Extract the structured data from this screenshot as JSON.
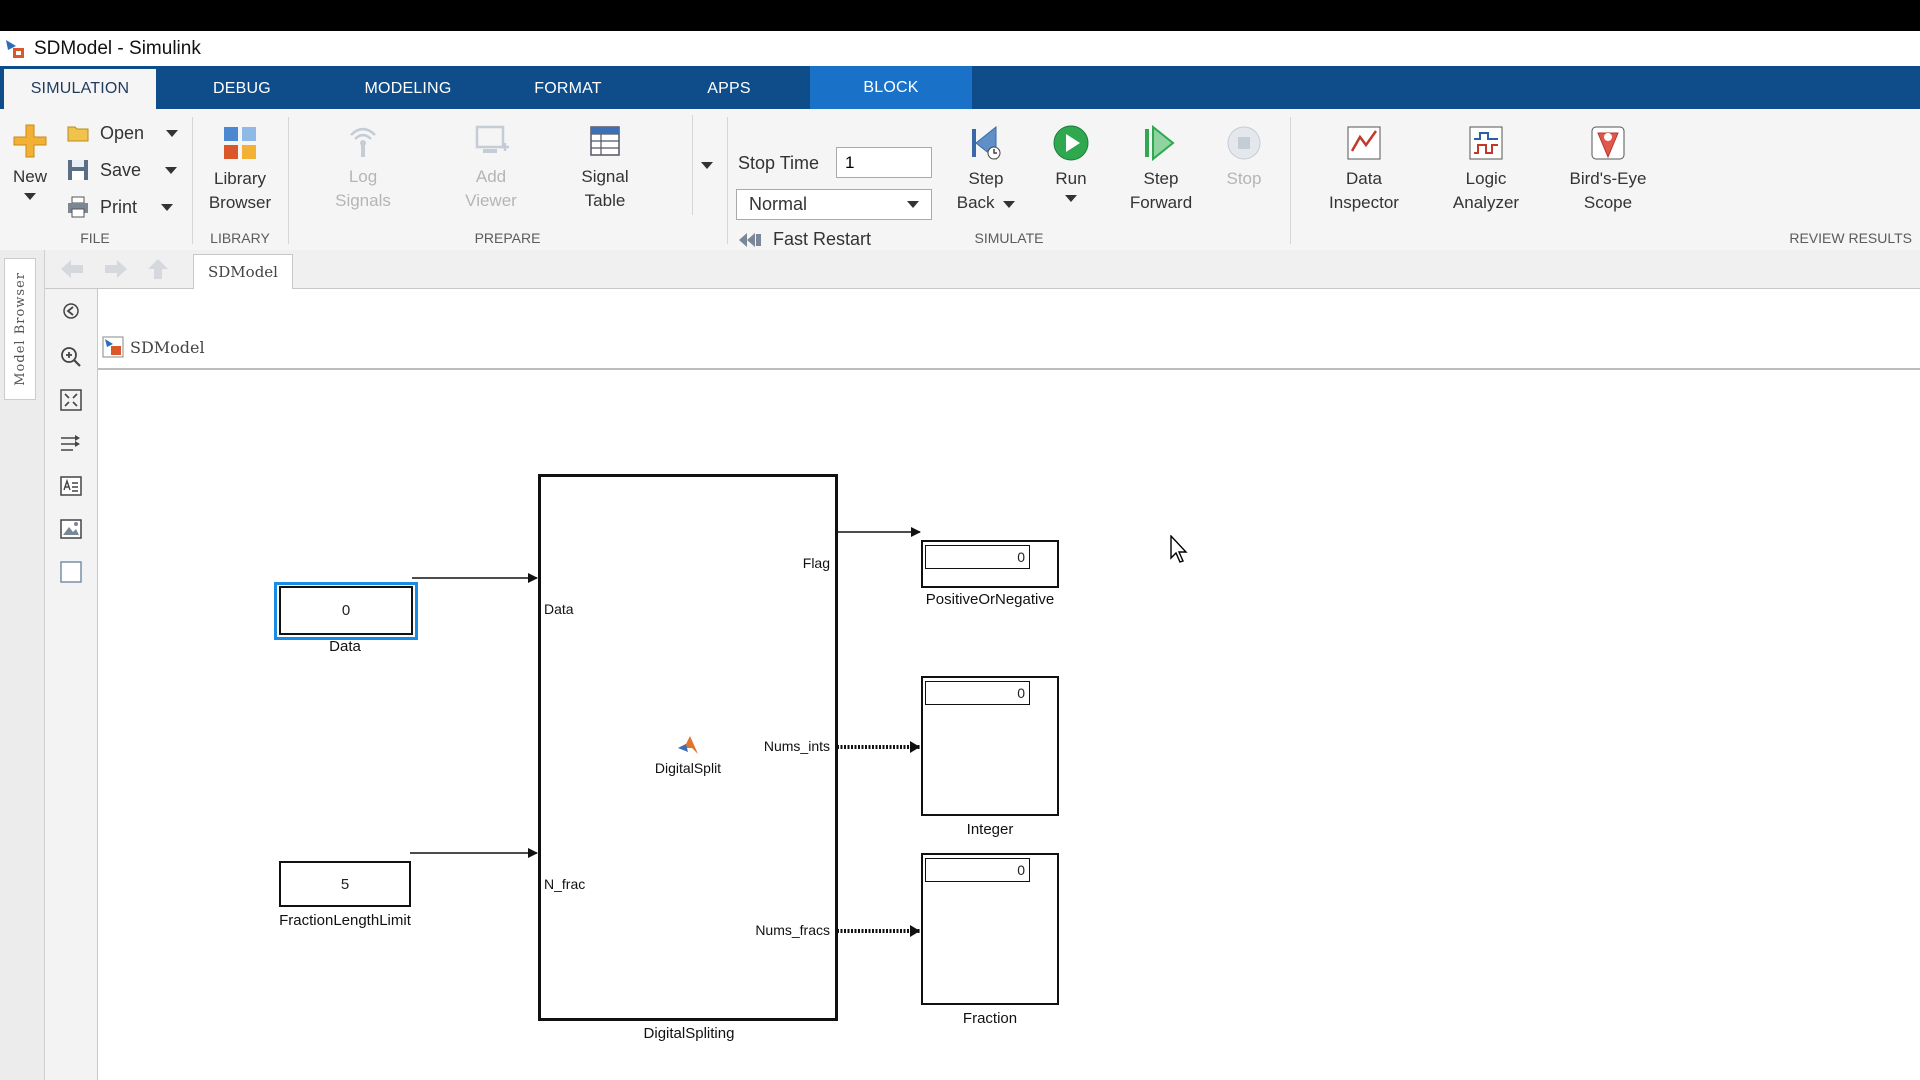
{
  "window": {
    "title": "SDModel - Simulink"
  },
  "tabs": [
    "SIMULATION",
    "DEBUG",
    "MODELING",
    "FORMAT",
    "APPS",
    "BLOCK"
  ],
  "ribbon": {
    "file": {
      "new": "New",
      "open": "Open",
      "save": "Save",
      "print": "Print",
      "label": "FILE"
    },
    "library": {
      "browser": [
        "Library",
        "Browser"
      ],
      "label": "LIBRARY"
    },
    "prepare": {
      "log_signals": [
        "Log",
        "Signals"
      ],
      "add_viewer": [
        "Add",
        "Viewer"
      ],
      "signal_table": [
        "Signal",
        "Table"
      ],
      "label": "PREPARE"
    },
    "simulate": {
      "stop_time_label": "Stop Time",
      "stop_time_value": "1",
      "mode": "Normal",
      "fast_restart": "Fast Restart",
      "step_back": [
        "Step",
        "Back"
      ],
      "run": "Run",
      "step_forward": [
        "Step",
        "Forward"
      ],
      "stop": "Stop",
      "label": "SIMULATE"
    },
    "review": {
      "data_inspector": [
        "Data",
        "Inspector"
      ],
      "logic_analyzer": [
        "Logic",
        "Analyzer"
      ],
      "birds_eye": [
        "Bird's-Eye",
        "Scope"
      ],
      "label": "REVIEW RESULTS"
    }
  },
  "side_tab": "Model Browser",
  "breadcrumb_tab": "SDModel",
  "path": "SDModel",
  "model": {
    "data_block": {
      "value": "0",
      "name": "Data"
    },
    "frac_block": {
      "value": "5",
      "name": "FractionLengthLimit"
    },
    "subsystem": {
      "name": "DigitalSpliting",
      "inner_label": "DigitalSplit",
      "inputs": [
        "Data",
        "N_frac"
      ],
      "outputs": [
        "Flag",
        "Nums_ints",
        "Nums_fracs"
      ]
    },
    "displays": [
      {
        "name": "PositiveOrNegative",
        "value": "0"
      },
      {
        "name": "Integer",
        "value": "0"
      },
      {
        "name": "Fraction",
        "value": "0"
      }
    ]
  },
  "colors": {
    "tab_bar": "#0e4c8a",
    "block_tab": "#1a72c8",
    "selection": "#1a8ce6"
  }
}
